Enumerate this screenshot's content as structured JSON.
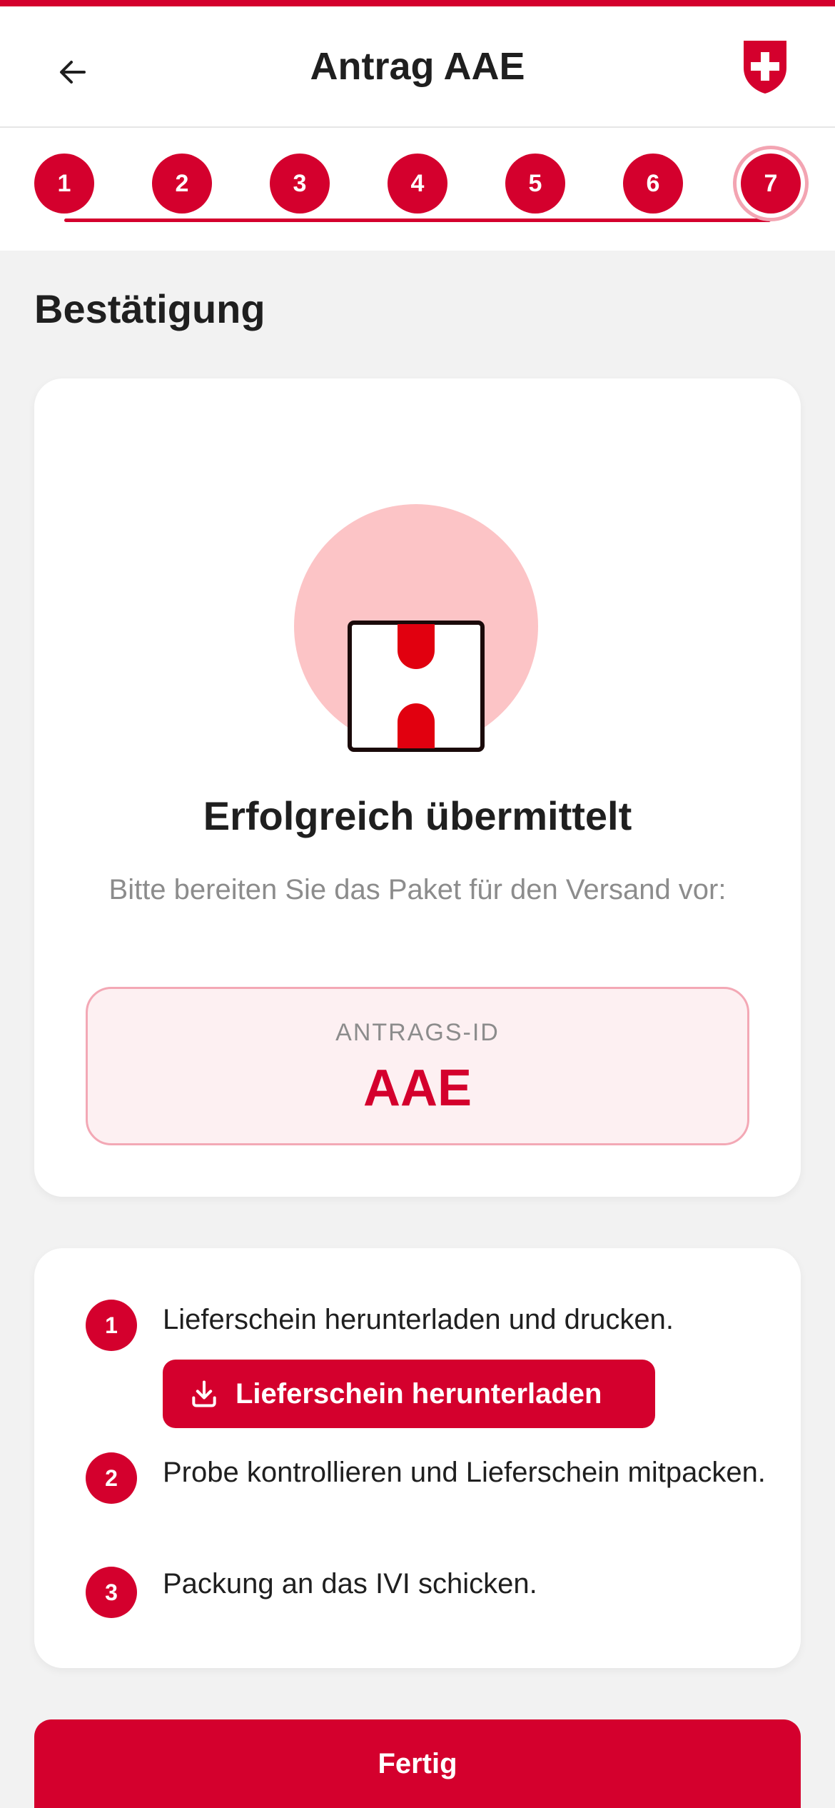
{
  "header": {
    "title": "Antrag AAE",
    "back_icon": "arrow-left-icon",
    "logo_icon": "swiss-cross-icon"
  },
  "stepper": {
    "steps": [
      "1",
      "2",
      "3",
      "4",
      "5",
      "6",
      "7"
    ],
    "active_step": "7"
  },
  "page": {
    "section_title": "Bestätigung"
  },
  "confirmation": {
    "illustration_icon": "package-icon",
    "title": "Erfolgreich übermittelt",
    "subtitle": "Bitte bereiten Sie das Paket für den Versand vor:",
    "id_label": "ANTRAGS-ID",
    "id_value": "AAE"
  },
  "instructions": {
    "items": [
      {
        "number": "1",
        "text": "Lieferschein herunterladen und drucken."
      },
      {
        "number": "2",
        "text": "Probe kontrollieren und Lieferschein mitpacken."
      },
      {
        "number": "3",
        "text": "Packung an das IVI schicken."
      }
    ],
    "download_label": "Lieferschein herunterladen",
    "download_icon": "download-icon"
  },
  "footer": {
    "done_label": "Fertig"
  },
  "colors": {
    "accent": "#d4002d",
    "light_accent": "#fcc4c6",
    "background": "#f2f2f2"
  }
}
